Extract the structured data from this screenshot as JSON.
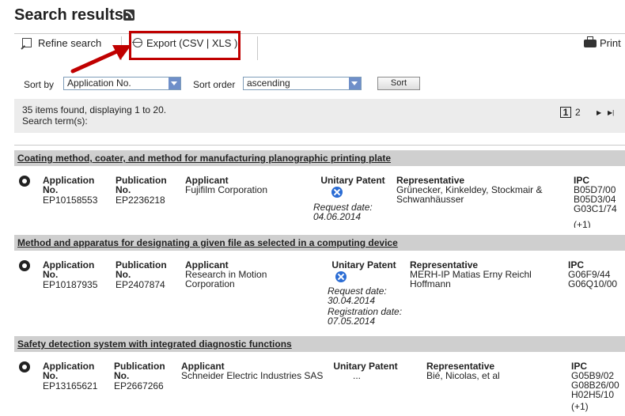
{
  "header": {
    "title": "Search results"
  },
  "toolbar": {
    "refine_label": "Refine search",
    "export_label": "Export  (CSV | XLS )",
    "print_label": "Print"
  },
  "sort": {
    "sort_by_label": "Sort by",
    "sort_by_value": "Application No.",
    "sort_order_label": "Sort order",
    "sort_order_value": "ascending",
    "sort_button": "Sort"
  },
  "info": {
    "found_text": "35 items found, displaying 1 to 20.",
    "search_term_label": "Search term(s):"
  },
  "pager": {
    "current": "1",
    "next_page": "2",
    "next_icon": "▶",
    "last_icon": "▶|"
  },
  "annotation": {
    "color": "#c00000"
  },
  "colors": {
    "row_header_bg": "#cfcfcf",
    "unitary_icon": "#2a6cd4"
  },
  "results": [
    {
      "title": "Coating method, coater, and method for manufacturing planographic printing plate",
      "application_label": "Application No.",
      "application_no": "EP10158553",
      "publication_label": "Publication No.",
      "publication_no": "EP2236218",
      "applicant_label": "Applicant",
      "applicant": "Fujifilm Corporation",
      "unitary_label": "Unitary Patent",
      "request_date": "Request date: 04.06.2014",
      "representative_label": "Representative",
      "representative": "Grünecker, Kinkeldey, Stockmair & Schwanhäusser",
      "ipc_label": "IPC",
      "ipc": [
        "B05D7/00",
        "B05D3/04",
        "G03C1/74",
        "(+1)"
      ]
    },
    {
      "title": "Method and apparatus for designating a given file as selected in a computing device",
      "application_label": "Application No.",
      "application_no": "EP10187935",
      "publication_label": "Publication No.",
      "publication_no": "EP2407874",
      "applicant_label": "Applicant",
      "applicant": "Research in Motion Corporation",
      "unitary_label": "Unitary Patent",
      "request_date": "Request date: 30.04.2014",
      "registration_date": "Registration date: 07.05.2014",
      "representative_label": "Representative",
      "representative": "MERH-IP Matias Erny Reichl Hoffmann",
      "ipc_label": "IPC",
      "ipc": [
        "G06F9/44",
        "G06Q10/00"
      ]
    },
    {
      "title": "Safety detection system with integrated diagnostic functions",
      "application_label": "Application No.",
      "application_no": "EP13165621",
      "publication_label": "Publication No.",
      "publication_no": "EP2667266",
      "applicant_label": "Applicant",
      "applicant": "Schneider Electric Industries SAS",
      "unitary_label": "Unitary Patent",
      "unitary_value": "...",
      "representative_label": "Representative",
      "representative": "Bié, Nicolas, et al",
      "ipc_label": "IPC",
      "ipc": [
        "G05B9/02",
        "G08B26/00",
        "H02H5/10",
        "(+1)"
      ]
    }
  ]
}
